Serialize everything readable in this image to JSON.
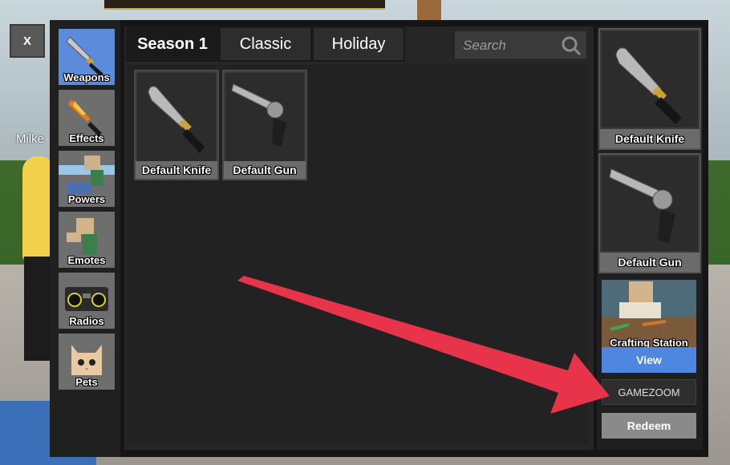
{
  "close_label": "X",
  "bg_player_name": "Milke",
  "sidebar": {
    "items": [
      {
        "label": "Weapons",
        "active": true,
        "icon": "knife-icon"
      },
      {
        "label": "Effects",
        "icon": "flame-knife-icon"
      },
      {
        "label": "Powers",
        "icon": "powers-icon"
      },
      {
        "label": "Emotes",
        "icon": "emote-character-icon"
      },
      {
        "label": "Radios",
        "icon": "radio-icon"
      },
      {
        "label": "Pets",
        "icon": "cat-pet-icon"
      }
    ]
  },
  "tabs": [
    {
      "label": "Season 1",
      "active": true
    },
    {
      "label": "Classic"
    },
    {
      "label": "Holiday"
    }
  ],
  "search": {
    "placeholder": "Search",
    "icon": "search-icon"
  },
  "inventory": [
    {
      "name": "Default Knife",
      "icon": "knife-icon"
    },
    {
      "name": "Default Gun",
      "icon": "revolver-icon"
    }
  ],
  "equipped": {
    "knife": {
      "name": "Default Knife",
      "icon": "knife-icon"
    },
    "gun": {
      "name": "Default Gun",
      "icon": "revolver-icon"
    }
  },
  "crafting": {
    "label": "Crafting Station",
    "icon": "crafting-station-icon"
  },
  "buttons": {
    "view": "View",
    "code_placeholder": "GAMEZOOM",
    "redeem": "Redeem"
  },
  "colors": {
    "accent": "#5d8bdc",
    "view_button": "#4f86e0",
    "arrow": "#e8344a"
  }
}
